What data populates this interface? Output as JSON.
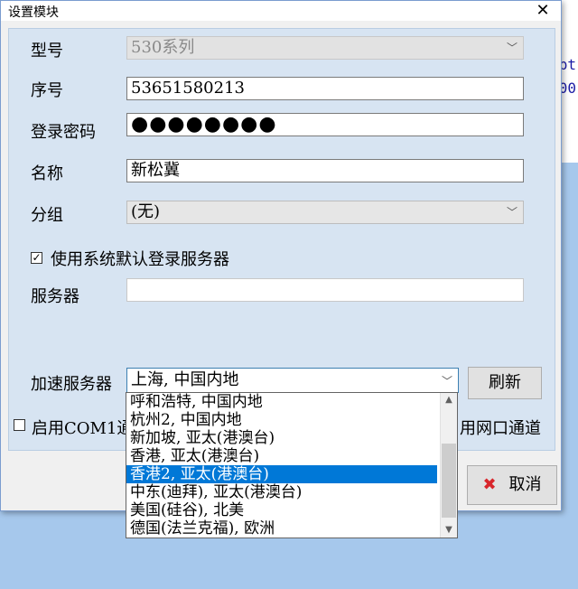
{
  "background": {
    "snippet_1": "pt",
    "snippet_2": "00"
  },
  "dialog": {
    "title": "设置模块",
    "close_glyph": "✕"
  },
  "form": {
    "model": {
      "label": "型号",
      "value": "530系列"
    },
    "serial": {
      "label": "序号",
      "value": "53651580213"
    },
    "password": {
      "label": "登录密码",
      "value": "●●●●●●●●"
    },
    "name": {
      "label": "名称",
      "value": "新松冀"
    },
    "group": {
      "label": "分组",
      "value": "(无)"
    },
    "use_default_server": {
      "label": "使用系统默认登录服务器",
      "checked": true
    },
    "server": {
      "label": "服务器",
      "value": ""
    },
    "accel_server": {
      "label": "加速服务器",
      "value": "上海, 中国内地"
    },
    "refresh_label": "刷新"
  },
  "channels": {
    "com1_label": "启用COM1通道",
    "net_label": "用网口通道"
  },
  "cancel_label": "取消",
  "dropdown": {
    "options": [
      "呼和浩特, 中国内地",
      "杭州2, 中国内地",
      "新加坡, 亚太(港澳台)",
      "香港, 亚太(港澳台)",
      "香港2, 亚太(港澳台)",
      "中东(迪拜), 亚太(港澳台)",
      "美国(硅谷), 北美",
      "德国(法兰克福), 欧洲"
    ],
    "selected_index": 4
  },
  "colors": {
    "selection": "#0078d7",
    "panel": "#d7e4f2",
    "cancel_icon": "#d8262b"
  }
}
